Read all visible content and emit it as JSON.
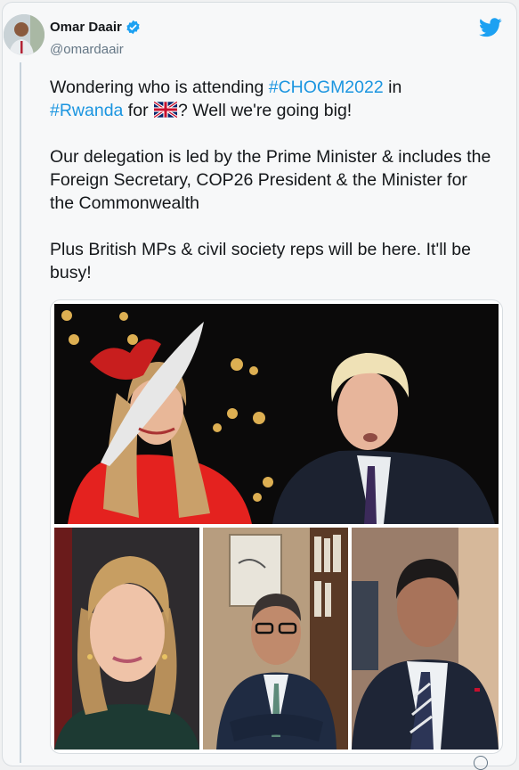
{
  "tweet": {
    "author_name": "Omar Daair",
    "author_handle": "@omardaair",
    "line1_pre": "Wondering who is attending ",
    "hashtag1": "#CHOGM2022",
    "line1_post": " in",
    "hashtag2": "#Rwanda",
    "line2_mid": " for ",
    "line2_post": "?  Well we're going big!",
    "paragraph2": "Our delegation is led by the Prime Minister & includes the Foreign Secretary, COP26 President & the Minister for the Commonwealth",
    "paragraph3": "Plus British MPs & civil society reps will be here. It'll be busy!"
  },
  "icons": {
    "verified": "verified-badge-icon",
    "platform": "twitter-bird-icon",
    "flag": "uk-flag-emoji"
  },
  "colors": {
    "link": "#1b95e0",
    "verified": "#1da1f2",
    "text": "#14171a",
    "secondary": "#657786"
  }
}
